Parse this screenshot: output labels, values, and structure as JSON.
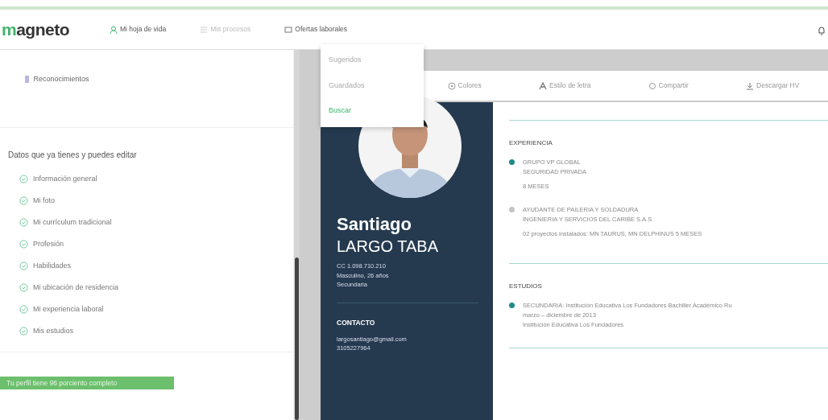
{
  "navbar": {
    "logo": "magneto",
    "items": [
      {
        "label": "Mi hoja de vida",
        "disabled": false
      },
      {
        "label": "Mis procesos",
        "disabled": true
      },
      {
        "label": "Ofertas laborales",
        "disabled": false
      }
    ]
  },
  "dropdown": {
    "items": [
      {
        "label": "Sugeridos",
        "selected": false
      },
      {
        "label": "Guardados",
        "selected": false
      },
      {
        "label": "Buscar",
        "selected": true
      }
    ]
  },
  "sidebar": {
    "top_item": "Reconocimientos",
    "section_title": "Datos que ya tienes y puedes editar",
    "items": [
      {
        "label": "Información general",
        "checked": true
      },
      {
        "label": "Mi foto",
        "checked": true
      },
      {
        "label": "Mi currículum tradicional",
        "checked": true
      },
      {
        "label": "Profesión",
        "checked": true
      },
      {
        "label": "Habilidades",
        "checked": true
      },
      {
        "label": "Mi ubicación de residencia",
        "checked": true
      },
      {
        "label": "Mi experiencia laboral",
        "checked": true
      },
      {
        "label": "Mis estudios",
        "checked": true
      }
    ],
    "progress_banner": "Tu perfil tiene 96 porciento completo"
  },
  "toolbar": [
    {
      "label": "Colores"
    },
    {
      "label": "Estilo de letra"
    },
    {
      "label": "Compartir"
    },
    {
      "label": "Descargar HV"
    }
  ],
  "cv": {
    "first_name": "Santiago",
    "last_name": "LARGO TABA",
    "details": [
      "CC 1.098.710.210",
      "Masculino, 26 años",
      "Secundaria"
    ],
    "contact_title": "CONTACTO",
    "contact": [
      "largosantiago@gmail.com",
      "3105227964"
    ],
    "experience_title": "EXPERIENCIA",
    "experience": [
      {
        "color": "#1f8a8a",
        "lines": [
          "GRUPO VP GLOBAL",
          "SEGURIDAD PRIVADA"
        ],
        "duration": "8 MESES"
      },
      {
        "color": "#c4c4c4",
        "lines": [
          "AYUDANTE DE PAILERIA Y SOLDADURA",
          "INGENIERIA Y SERVICIOS DEL CARIBE S.A.S"
        ],
        "duration": "02 proyectos instalados: MN TAURUS, MN DELPHINUS 5 MESES"
      }
    ],
    "studies_title": "ESTUDIOS",
    "studies": [
      {
        "color": "#1f8a8a",
        "lines": [
          "SECUNDARIA: Institución Educativa Los Fundadores Bachiller Académico Ru",
          "marzo – diciembre de 2013",
          "Institución Educativa Los Fundadores"
        ]
      }
    ]
  }
}
